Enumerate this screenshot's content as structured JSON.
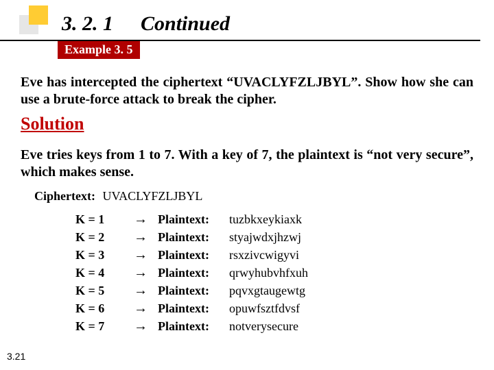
{
  "header": {
    "section_number": "3. 2. 1",
    "section_title": "Continued",
    "example_label": "Example 3. 5"
  },
  "problem_text": "Eve has intercepted the ciphertext “UVACLYFZLJBYL”. Show how she can use a brute-force attack to break the cipher.",
  "solution_label": "Solution",
  "solution_text": "Eve tries keys from 1 to 7. With a key of 7, the plaintext is “not very secure”, which makes sense.",
  "ciphertext_label": "Ciphertext:",
  "ciphertext_value": "UVACLYFZLJBYL",
  "plaintext_label": "Plaintext:",
  "rows": [
    {
      "k": "K = 1",
      "pt": "tuzbkxeykiaxk"
    },
    {
      "k": "K = 2",
      "pt": "styajwdxjhzwj"
    },
    {
      "k": "K = 3",
      "pt": "rsxzivcwigyvi"
    },
    {
      "k": "K = 4",
      "pt": "qrwyhubvhfxuh"
    },
    {
      "k": "K = 5",
      "pt": "pqvxgtaugewtg"
    },
    {
      "k": "K = 6",
      "pt": "opuwfsztfdvsf"
    },
    {
      "k": "K = 7",
      "pt": "notverysecure"
    }
  ],
  "page_number": "3.21"
}
